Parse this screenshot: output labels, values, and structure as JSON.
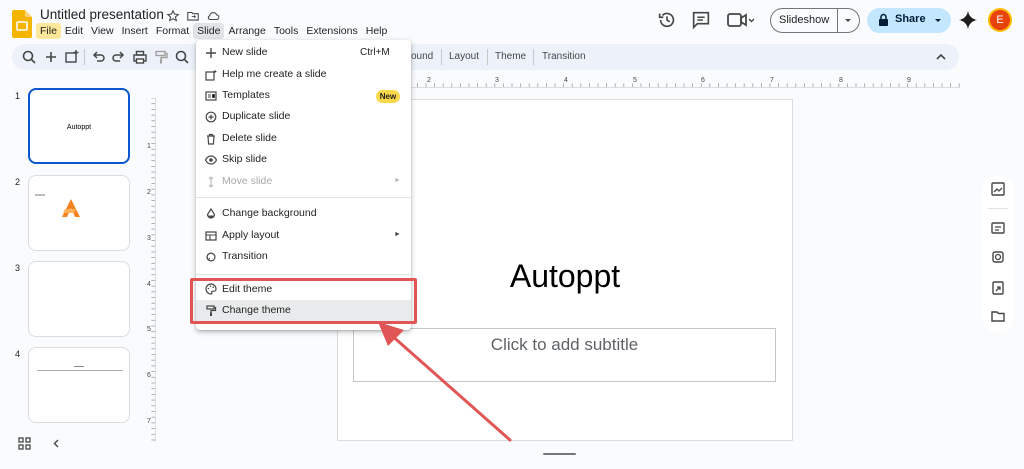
{
  "doc": {
    "title": "Untitled presentation"
  },
  "menubar": [
    "File",
    "Edit",
    "View",
    "Insert",
    "Format",
    "Slide",
    "Arrange",
    "Tools",
    "Extensions",
    "Help"
  ],
  "header": {
    "slideshow_label": "Slideshow",
    "share_label": "Share",
    "avatar_initial": "E"
  },
  "toolbar": {
    "background_label": "ound",
    "layout_label": "Layout",
    "theme_label": "Theme",
    "transition_label": "Transition"
  },
  "filmstrip": {
    "slides": [
      {
        "number": "1",
        "title": "Autoppt"
      },
      {
        "number": "2",
        "title": ""
      },
      {
        "number": "3",
        "title": ""
      },
      {
        "number": "4",
        "title": ""
      }
    ]
  },
  "slide": {
    "title": "Autoppt",
    "subtitle_placeholder": "Click to add subtitle"
  },
  "ruler": {
    "top": [
      "2",
      "3",
      "4",
      "5",
      "6",
      "7",
      "8",
      "9"
    ],
    "left": [
      "1",
      "2",
      "3",
      "4",
      "5",
      "6",
      "7"
    ]
  },
  "slide_menu": {
    "items": [
      {
        "label": "New slide",
        "shortcut": "Ctrl+M",
        "icon": "plus-icon"
      },
      {
        "label": "Help me create a slide",
        "icon": "sparkle-slide-icon"
      },
      {
        "label": "Templates",
        "badge": "New",
        "icon": "templates-icon"
      },
      {
        "label": "Duplicate slide",
        "icon": "duplicate-icon"
      },
      {
        "label": "Delete slide",
        "icon": "trash-icon"
      },
      {
        "label": "Skip slide",
        "icon": "eye-icon"
      },
      {
        "label": "Move slide",
        "disabled": true,
        "submenu": true,
        "icon": "move-icon"
      },
      {
        "label": "Change background",
        "icon": "paint-drop-icon"
      },
      {
        "label": "Apply layout",
        "submenu": true,
        "icon": "layout-icon"
      },
      {
        "label": "Transition",
        "icon": "transition-icon"
      },
      {
        "label": "Edit theme",
        "icon": "palette-icon"
      },
      {
        "label": "Change theme",
        "icon": "paint-roller-icon"
      }
    ]
  },
  "colors": {
    "accent": "#0b57d0",
    "share_bg": "#c2e7ff",
    "highlight": "#e05656",
    "file_menu_bg": "#fde79a"
  }
}
